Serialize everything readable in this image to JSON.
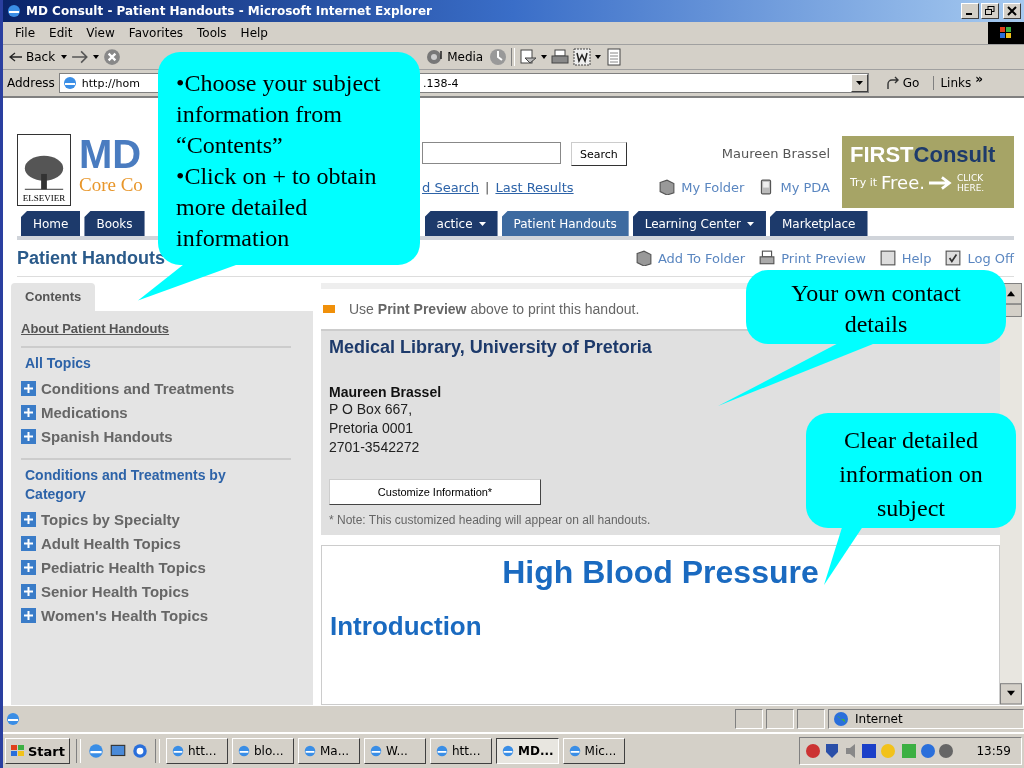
{
  "window": {
    "title": "MD Consult - Patient Handouts - Microsoft Internet Explorer"
  },
  "menu": [
    "File",
    "Edit",
    "View",
    "Favorites",
    "Tools",
    "Help"
  ],
  "toolbar": {
    "back": "Back",
    "media": "Media"
  },
  "address": {
    "label": "Address",
    "value_parts": [
      "http://hom",
      ".138-4"
    ],
    "go": "Go",
    "links": "Links",
    "links_more": "»"
  },
  "header": {
    "logo": {
      "publisher": "ELSEVIER",
      "mark": "MD",
      "tagline": "Core Co"
    },
    "search_button": "Search",
    "links": [
      "d Search",
      "Last Results"
    ],
    "link_separator": "|",
    "user": "Maureen Brassel",
    "my_folder": "My Folder",
    "my_pda": "My PDA",
    "ad": {
      "title_a": "FIRST",
      "title_b": "Consult",
      "try": "Try it",
      "free": "Free.",
      "cta": [
        "CLICK",
        "HERE."
      ]
    }
  },
  "nav_tabs": [
    {
      "label": "Home",
      "dropdown": false,
      "selected": false
    },
    {
      "label": "Books",
      "dropdown": false,
      "selected": false
    },
    {
      "label": "actice",
      "dropdown": true,
      "selected": false
    },
    {
      "label": "Patient Handouts",
      "dropdown": false,
      "selected": true
    },
    {
      "label": "Learning Center",
      "dropdown": true,
      "selected": false
    },
    {
      "label": "Marketplace",
      "dropdown": false,
      "selected": false
    }
  ],
  "page_title": "Patient Handouts",
  "page_actions": {
    "add": "Add To Folder",
    "print": "Print Preview",
    "help": "Help",
    "logoff": "Log Off"
  },
  "sidebar": {
    "tab": "Contents",
    "about": "About Patient Handouts",
    "sections": [
      {
        "title": "All Topics",
        "items": [
          {
            "label": "Conditions and Treatments",
            "expanded": false
          },
          {
            "label": "Medications",
            "expanded": false
          },
          {
            "label": "Spanish Handouts",
            "expanded": false
          }
        ]
      },
      {
        "title": "Conditions and Treatments by Category",
        "items": [
          {
            "label": "Topics by Specialty",
            "expanded": false
          },
          {
            "label": "Adult Health Topics",
            "expanded": false
          },
          {
            "label": "Pediatric Health Topics",
            "expanded": false
          },
          {
            "label": "Senior Health Topics",
            "expanded": false
          },
          {
            "label": "Women's Health Topics",
            "expanded": false
          }
        ]
      }
    ]
  },
  "content": {
    "notice": "Use **Print Preview** above to print this handout.",
    "contact": {
      "heading": "Medical Library, University of Pretoria",
      "name": "Maureen Brassel",
      "lines": [
        "P O Box 667,",
        "Pretoria 0001",
        "2701-3542272"
      ],
      "button": "Customize Information*",
      "note": "* Note: This customized heading will appear on all handouts."
    },
    "article": {
      "title": "High Blood Pressure",
      "section": "Introduction"
    }
  },
  "status_bar": {
    "zone": "Internet"
  },
  "taskbar": {
    "start": "Start",
    "tasks": [
      {
        "label": "htt...",
        "selected": false
      },
      {
        "label": "blo...",
        "selected": false
      },
      {
        "label": "Ma...",
        "selected": false
      },
      {
        "label": "W...",
        "selected": false
      },
      {
        "label": "htt...",
        "selected": false
      },
      {
        "label": "MD...",
        "selected": true
      },
      {
        "label": "Mic...",
        "selected": false
      }
    ],
    "clock": "13:59"
  },
  "callouts": [
    {
      "lines": [
        "•Choose your subject information from “Contents”",
        "•Click on + to obtain more detailed information"
      ]
    },
    {
      "lines": [
        "Your own contact details"
      ]
    },
    {
      "lines": [
        "Clear detailed information on subject"
      ]
    }
  ]
}
